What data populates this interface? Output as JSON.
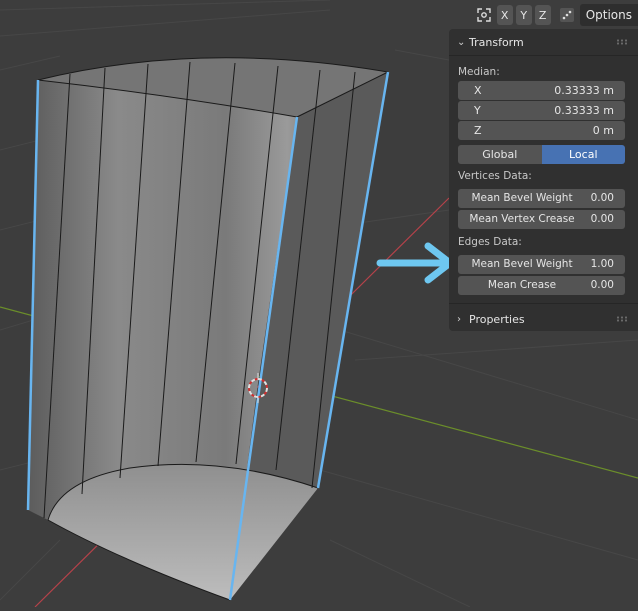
{
  "header": {
    "axis_x": "X",
    "axis_y": "Y",
    "axis_z": "Z",
    "options_label": "Options",
    "icons": [
      "gizmo-axes-icon",
      "snap-settings-icon"
    ]
  },
  "transform_panel": {
    "title": "Transform",
    "median_label": "Median:",
    "fields": [
      {
        "name": "X",
        "value": "0.33333 m"
      },
      {
        "name": "Y",
        "value": "0.33333 m"
      },
      {
        "name": "Z",
        "value": "0 m"
      }
    ],
    "space_options": [
      "Global",
      "Local"
    ],
    "space_selected": "Local",
    "vertices_label": "Vertices Data:",
    "vertices_fields": [
      {
        "name": "Mean Bevel Weight",
        "value": "0.00"
      },
      {
        "name": "Mean Vertex Crease",
        "value": "0.00"
      }
    ],
    "edges_label": "Edges Data:",
    "edges_fields": [
      {
        "name": "Mean Bevel Weight",
        "value": "1.00"
      },
      {
        "name": "Mean Crease",
        "value": "0.00"
      }
    ]
  },
  "properties_panel": {
    "title": "Properties"
  },
  "colors": {
    "viewport_bg": "#3d3d3d",
    "panel_bg": "#303030",
    "field_bg": "#545454",
    "selected_blue": "#4772b3",
    "edge_highlight": "#68b5f0",
    "annotation_arrow": "#6ec7f0",
    "x_axis": "#b5424a",
    "y_axis": "#6b8e2a"
  }
}
